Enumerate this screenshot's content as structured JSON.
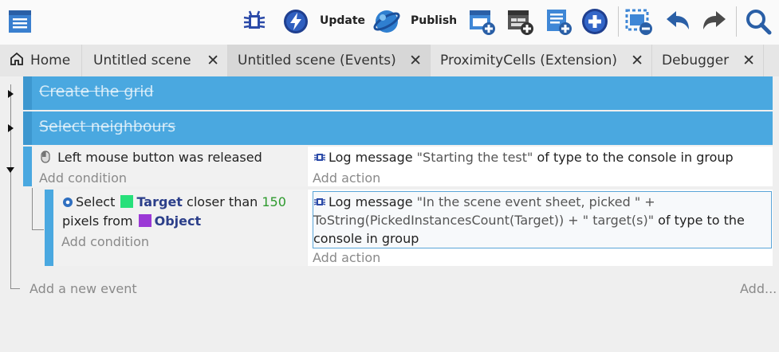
{
  "toolbar": {
    "update_label": "Update",
    "publish_label": "Publish",
    "icons": [
      "project-manager-icon",
      "debugger-bug-icon",
      "preview-lightning-icon",
      "publish-globe-icon",
      "add-event-icon",
      "add-subevent-icon",
      "add-comment-icon",
      "add-other-icon",
      "delete-event-icon",
      "undo-arrow-icon",
      "redo-arrow-icon",
      "search-icon"
    ]
  },
  "tabs": [
    {
      "label": "Home",
      "closable": false
    },
    {
      "label": "Untitled scene",
      "closable": true
    },
    {
      "label": "Untitled scene (Events)",
      "closable": true,
      "active": true
    },
    {
      "label": "ProximityCells (Extension)",
      "closable": true
    },
    {
      "label": "Debugger",
      "closable": true
    }
  ],
  "close_glyph": "✕",
  "groups": [
    {
      "title": "Create the grid"
    },
    {
      "title": "Select neighbours"
    }
  ],
  "event1": {
    "condition": "Left mouse button was released",
    "add_condition": "Add condition",
    "action": {
      "prefix": "Log message",
      "text": "\"Starting the test\"",
      "suffix": "of type  to the console in group"
    },
    "add_action": "Add action"
  },
  "event2": {
    "cond_select": "Select",
    "cond_object1": "Target",
    "cond_mid": "closer than",
    "cond_number": "150",
    "cond_line2_prefix": "pixels from",
    "cond_object2": "Object",
    "add_condition": "Add condition",
    "action": {
      "prefix": "Log message",
      "line1_text": "\"In the scene event sheet, picked \" +",
      "line2_text": "ToString(PickedInstancesCount(Target)) + \" target(s)\"",
      "line2_suffix": "of type  to the",
      "line3": "console in group"
    },
    "add_action": "Add action"
  },
  "add_new_event": "Add a new event",
  "add_other": "Add...",
  "colors": {
    "group_blue": "#4aa8e0",
    "target_green": "#27e07a",
    "object_purple": "#9b39d6",
    "number_green": "#2e9a2e"
  }
}
